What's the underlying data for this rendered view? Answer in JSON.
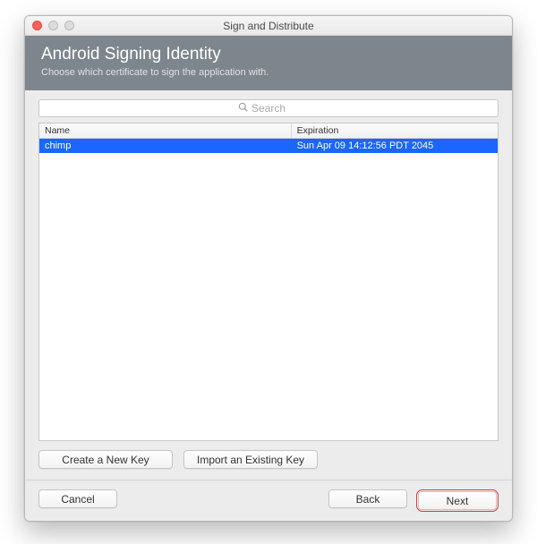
{
  "window": {
    "title": "Sign and Distribute"
  },
  "header": {
    "title": "Android Signing Identity",
    "subtitle": "Choose which certificate to sign the application with."
  },
  "search": {
    "placeholder": "Search"
  },
  "table": {
    "columns": {
      "name": "Name",
      "expiration": "Expiration"
    },
    "rows": [
      {
        "name": "chimp",
        "expiration": "Sun Apr 09 14:12:56 PDT 2045",
        "selected": true
      }
    ]
  },
  "actions": {
    "create_key": "Create a New Key",
    "import_key": "Import an Existing Key"
  },
  "footer": {
    "cancel": "Cancel",
    "back": "Back",
    "next": "Next"
  }
}
